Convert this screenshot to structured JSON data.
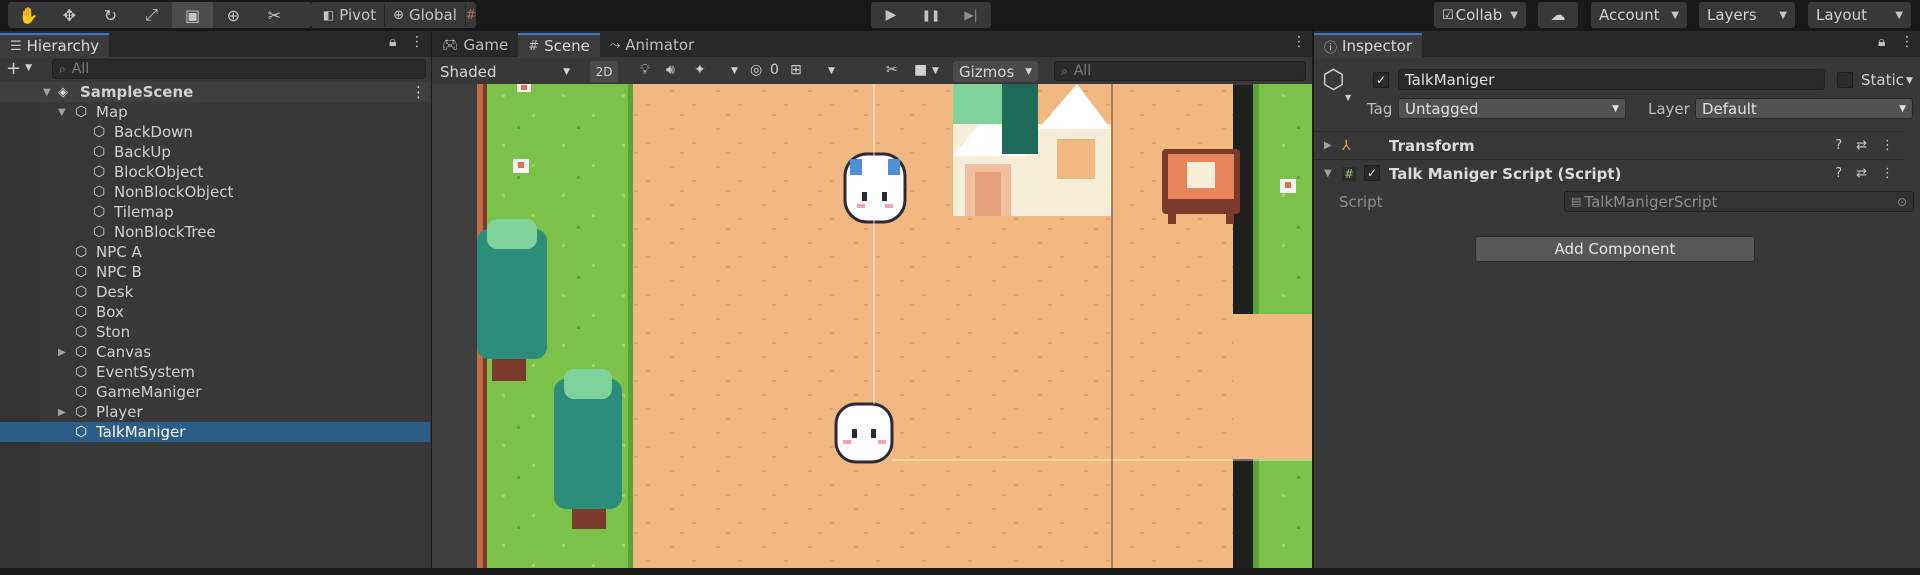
{
  "toolbar": {
    "tools": [
      {
        "name": "hand-tool",
        "glyph": "✋"
      },
      {
        "name": "move-tool",
        "glyph": "✥"
      },
      {
        "name": "rotate-tool",
        "glyph": "↻"
      },
      {
        "name": "scale-tool",
        "glyph": "⤢"
      },
      {
        "name": "rect-tool",
        "glyph": "▣"
      },
      {
        "name": "transform-tool",
        "glyph": "⊕"
      },
      {
        "name": "custom-tool",
        "glyph": "✂"
      }
    ],
    "pivot_label": "Pivot",
    "global_label": "Global",
    "play_glyph": "▶",
    "pause_glyph": "❚❚",
    "step_glyph": "▶|",
    "collab_label": "Collab",
    "account_label": "Account",
    "layers_label": "Layers",
    "layout_label": "Layout"
  },
  "hierarchy": {
    "tab_label": "Hierarchy",
    "search_placeholder": "All",
    "scene_name": "SampleScene",
    "items": [
      {
        "label": "Map",
        "depth": 1,
        "foldout": "open"
      },
      {
        "label": "BackDown",
        "depth": 2
      },
      {
        "label": "BackUp",
        "depth": 2
      },
      {
        "label": "BlockObject",
        "depth": 2
      },
      {
        "label": "NonBlockObject",
        "depth": 2
      },
      {
        "label": "Tilemap",
        "depth": 2
      },
      {
        "label": "NonBlockTree",
        "depth": 2
      },
      {
        "label": "NPC A",
        "depth": 1
      },
      {
        "label": "NPC B",
        "depth": 1
      },
      {
        "label": "Desk",
        "depth": 1
      },
      {
        "label": "Box",
        "depth": 1
      },
      {
        "label": "Ston",
        "depth": 1
      },
      {
        "label": "Canvas",
        "depth": 1,
        "foldout": "closed"
      },
      {
        "label": "EventSystem",
        "depth": 1
      },
      {
        "label": "GameManiger",
        "depth": 1
      },
      {
        "label": "Player",
        "depth": 1,
        "foldout": "closed"
      },
      {
        "label": "TalkManiger",
        "depth": 1,
        "selected": true
      }
    ]
  },
  "scene": {
    "tabs": [
      "Game",
      "Scene",
      "Animator"
    ],
    "active_tab": "Scene",
    "shading_mode": "Shaded",
    "mode_2d": "2D",
    "hidden_count": "0",
    "gizmos_label": "Gizmos",
    "search_placeholder": "All"
  },
  "inspector": {
    "tab_label": "Inspector",
    "object_name": "TalkManiger",
    "static_label": "Static",
    "tag_label": "Tag",
    "tag_value": "Untagged",
    "layer_label": "Layer",
    "layer_value": "Default",
    "components": [
      {
        "title": "Transform"
      },
      {
        "title": "Talk Maniger Script (Script)"
      }
    ],
    "script_field_label": "Script",
    "script_field_value": "TalkManigerScript",
    "add_component_label": "Add Component"
  },
  "colors": {
    "selection": "#2c5d87",
    "panel_bg": "#383838",
    "tab_accent": "#3a79bb",
    "sand": "#f1b981",
    "grass": "#7cc24a"
  }
}
